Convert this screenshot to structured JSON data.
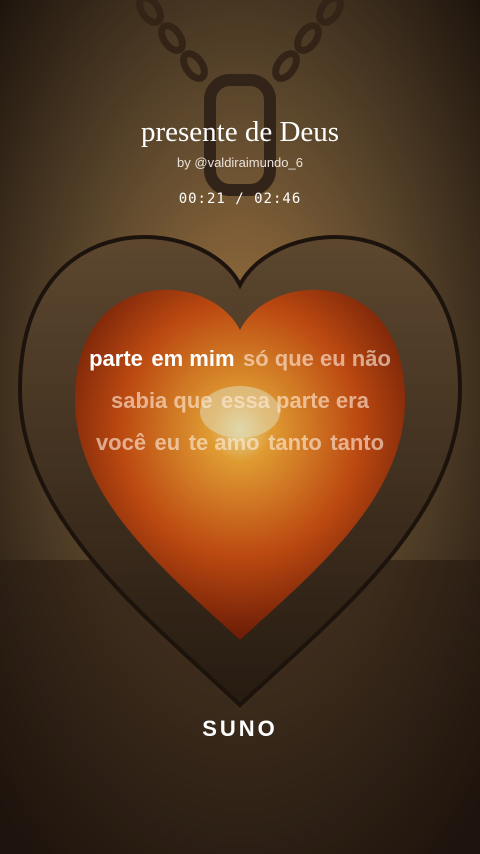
{
  "song": {
    "title": "presente de Deus",
    "artist": "by @valdiraimundo_6",
    "time": "00:21 / 02:46"
  },
  "lyrics": [
    {
      "words": [
        {
          "text": "parte",
          "active": true
        },
        {
          "text": "em mim",
          "active": true
        },
        {
          "text": "só que eu não",
          "active": false
        }
      ]
    },
    {
      "words": [
        {
          "text": "sabia que",
          "active": false
        },
        {
          "text": "essa parte era",
          "active": false
        }
      ]
    },
    {
      "words": [
        {
          "text": "você",
          "active": false
        },
        {
          "text": "eu",
          "active": false
        },
        {
          "text": "te amo",
          "active": false
        },
        {
          "text": "tanto",
          "active": false
        },
        {
          "text": "tanto",
          "active": false
        }
      ]
    }
  ],
  "brand": {
    "logo": "SUNO"
  }
}
